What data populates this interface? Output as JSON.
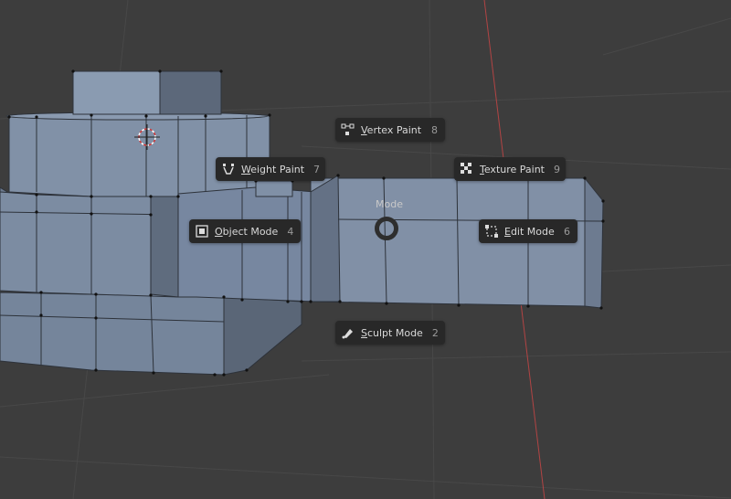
{
  "pie_menu": {
    "title": "Mode",
    "items": [
      {
        "label_first": "V",
        "label_rest": "ertex Paint",
        "shortcut": "8"
      },
      {
        "label_first": "W",
        "label_rest": "eight Paint",
        "shortcut": "7"
      },
      {
        "label_first": "T",
        "label_rest": "exture Paint",
        "shortcut": "9"
      },
      {
        "label_first": "O",
        "label_rest": "bject Mode",
        "shortcut": "4"
      },
      {
        "label_first": "E",
        "label_rest": "dit Mode",
        "shortcut": "6"
      },
      {
        "label_first": "S",
        "label_rest": "culpt Mode",
        "shortcut": "2"
      }
    ]
  },
  "icons": {
    "vertex_paint": "vertex-paint-icon",
    "weight_paint": "weight-paint-icon",
    "texture_paint": "texture-paint-icon",
    "object_mode": "object-mode-icon",
    "edit_mode": "edit-mode-icon",
    "sculpt_mode": "sculpt-mode-icon"
  },
  "colors": {
    "viewport_bg": "#3d3d3d",
    "mesh_face": "#7b8aa0",
    "pie_item_bg": "#282828",
    "x_axis": "#c94b4b"
  }
}
